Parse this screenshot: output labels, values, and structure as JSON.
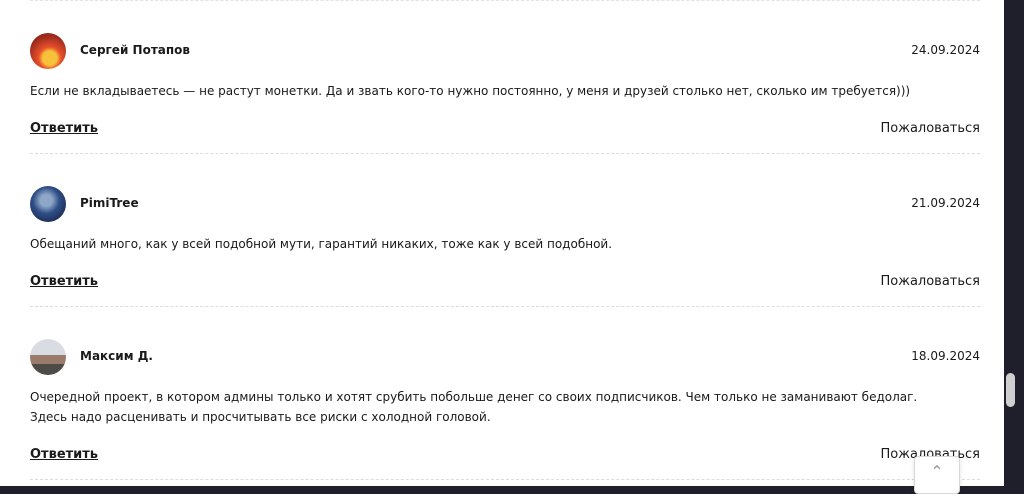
{
  "comments": [
    {
      "author": "Сергей Потапов",
      "date": "24.09.2024",
      "text": "Если не вкладываетесь — не растут монетки. Да и звать кого-то нужно постоянно, у меня и друзей столько нет, сколько им требуется)))",
      "reply_label": "Ответить",
      "report_label": "Пожаловаться"
    },
    {
      "author": "PimiTree",
      "date": "21.09.2024",
      "text": "Обещаний много, как у всей подобной мути, гарантий никаких, тоже как у всей подобной.",
      "reply_label": "Ответить",
      "report_label": "Пожаловаться"
    },
    {
      "author": "Максим Д.",
      "date": "18.09.2024",
      "text": "Очередной проект, в котором админы только и хотят срубить побольше денег со своих подписчиков. Чем только не заманивают бедолаг. Здесь надо расценивать и просчитывать все риски с холодной головой.",
      "reply_label": "Ответить",
      "report_label": "Пожаловаться"
    }
  ],
  "scroll_top_icon": "chevron-up-icon"
}
